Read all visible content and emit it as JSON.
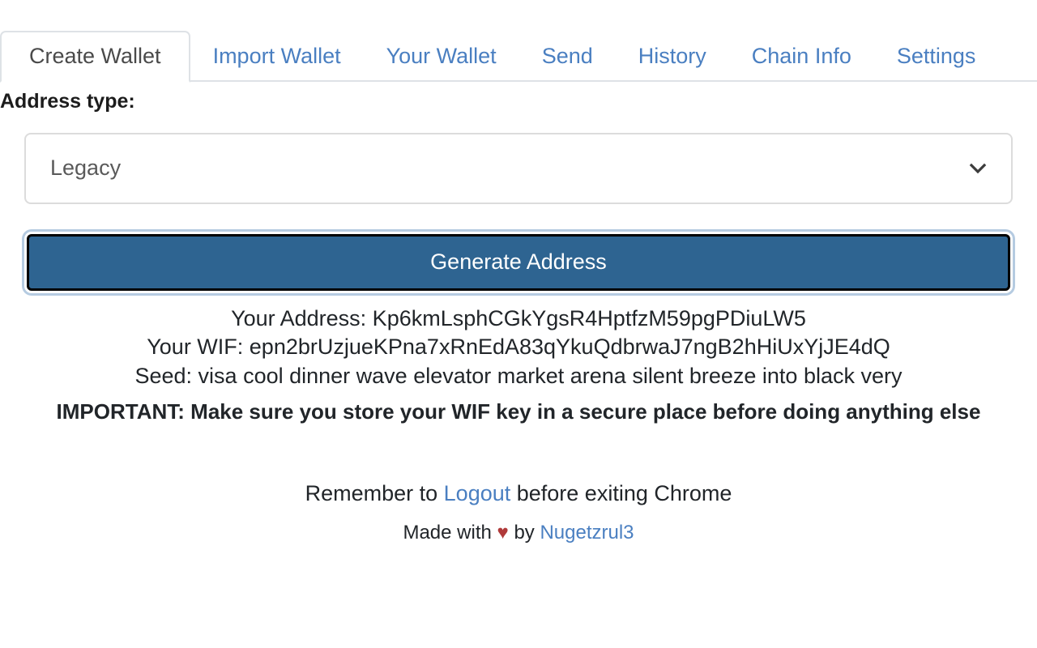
{
  "tabs": [
    {
      "label": "Create Wallet",
      "active": true
    },
    {
      "label": "Import Wallet",
      "active": false
    },
    {
      "label": "Your Wallet",
      "active": false
    },
    {
      "label": "Send",
      "active": false
    },
    {
      "label": "History",
      "active": false
    },
    {
      "label": "Chain Info",
      "active": false
    },
    {
      "label": "Settings",
      "active": false
    }
  ],
  "form": {
    "address_type_label": "Address type:",
    "address_type_value": "Legacy",
    "address_type_options": [
      "Legacy"
    ],
    "generate_button_label": "Generate Address"
  },
  "result": {
    "address_line": "Your Address: Kp6kmLsphCGkYgsR4HptfzM59pgPDiuLW5",
    "wif_line": "Your WIF: epn2brUzjueKPna7xRnEdA83qYkuQdbrwaJ7ngB2hHiUxYjJE4dQ",
    "seed_line": "Seed: visa cool dinner wave elevator market arena silent breeze into black very",
    "important_line": "IMPORTANT: Make sure you store your WIF key in a secure place before doing anything else"
  },
  "footer": {
    "remember_prefix": "Remember to ",
    "logout_link": "Logout",
    "remember_suffix": " before exiting Chrome",
    "made_with_prefix": "Made with ",
    "heart": "♥",
    "made_with_mid": " by ",
    "author_link": "Nugetzrul3"
  },
  "colors": {
    "link": "#4a7fc1",
    "button": "#2e6491",
    "heart": "#b03a3a",
    "border": "#dee2e6"
  }
}
